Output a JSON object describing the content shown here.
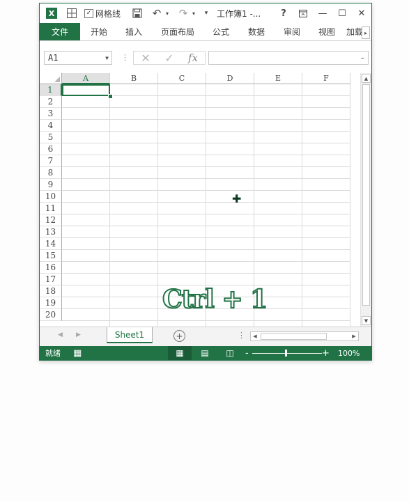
{
  "title_bar": {
    "app_icon": "excel-logo-icon",
    "app_icon_text": "X",
    "qa_grid_icon": "table-grid-icon",
    "gridlines_label": "网格线",
    "gridlines_checked": true,
    "checkmark": "✓",
    "save_icon": "💾",
    "undo_icon": "↶",
    "redo_icon": "↷",
    "dropdown_icon": "▾",
    "customize_icon": "⋮",
    "title": "工作簿1 -...",
    "help": "?",
    "ribbon_display": "▣",
    "minimize": "—",
    "maximize": "☐",
    "close": "✕"
  },
  "ribbon_tabs": [
    "文件",
    "开始",
    "插入",
    "页面布局",
    "公式",
    "数据",
    "审阅",
    "视图",
    "加载"
  ],
  "ribbon_scroll": "▸",
  "formula_bar": {
    "name_box": "A1",
    "dropdown": "▼",
    "separator": "⋮",
    "cancel": "✕",
    "enter": "✓",
    "fx": "fx",
    "formula": "",
    "expand": "⌄"
  },
  "grid": {
    "columns": [
      "A",
      "B",
      "C",
      "D",
      "E",
      "F"
    ],
    "rows": [
      "1",
      "2",
      "3",
      "4",
      "5",
      "6",
      "7",
      "8",
      "9",
      "10",
      "11",
      "12",
      "13",
      "14",
      "15",
      "16",
      "17",
      "18",
      "19",
      "20"
    ],
    "active_cell": "A1",
    "cursor_glyph": "✚"
  },
  "overlay_text": "Ctrl + 1",
  "vscroll": {
    "up": "▲",
    "down": "▼"
  },
  "sheet_bar": {
    "prev": "◀",
    "next": "▶",
    "sheet_tab": "Sheet1",
    "add_sheet": "+",
    "dots": "⋮",
    "hscroll_left": "◀",
    "hscroll_right": "▶"
  },
  "status_bar": {
    "status": "就绪",
    "macro_icon": "▦",
    "view_normal": "▦",
    "view_page_layout": "▤",
    "view_page_break": "◫",
    "zoom_out": "-",
    "zoom_in": "+",
    "zoom": "100%"
  },
  "colors": {
    "accent": "#217346",
    "active_view": "#1a5c38"
  }
}
